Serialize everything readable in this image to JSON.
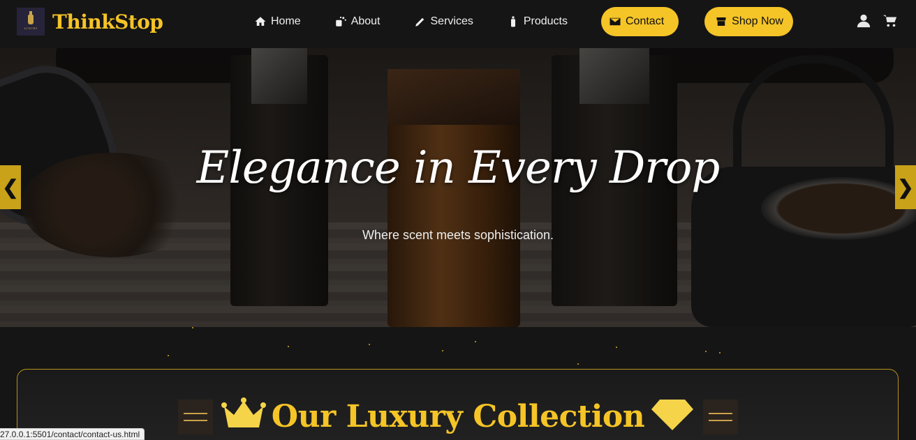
{
  "brand": {
    "name": "ThinkStop",
    "logo_icon": "perfume-logo",
    "logo_caption": "LUXURY"
  },
  "nav": {
    "items": [
      {
        "label": "Home",
        "icon": "home-icon"
      },
      {
        "label": "About",
        "icon": "about-icon"
      },
      {
        "label": "Services",
        "icon": "pen-icon"
      },
      {
        "label": "Products",
        "icon": "bottle-icon"
      },
      {
        "label": "Contact",
        "icon": "envelope-icon"
      },
      {
        "label": "Shop Now",
        "icon": "store-icon"
      }
    ],
    "user_icon": "user-icon",
    "cart_icon": "cart-icon"
  },
  "hero": {
    "title": "Elegance in Every Drop",
    "subtitle": "Where scent meets sophistication.",
    "prev_label": "❮",
    "next_label": "❯"
  },
  "collection": {
    "title": "Our Luxury Collection"
  },
  "status_bar": {
    "url": "27.0.0.1:5501/contact/contact-us.html"
  },
  "colors": {
    "accent": "#f5c427",
    "background": "#151515",
    "arrow": "#c9a21a"
  }
}
